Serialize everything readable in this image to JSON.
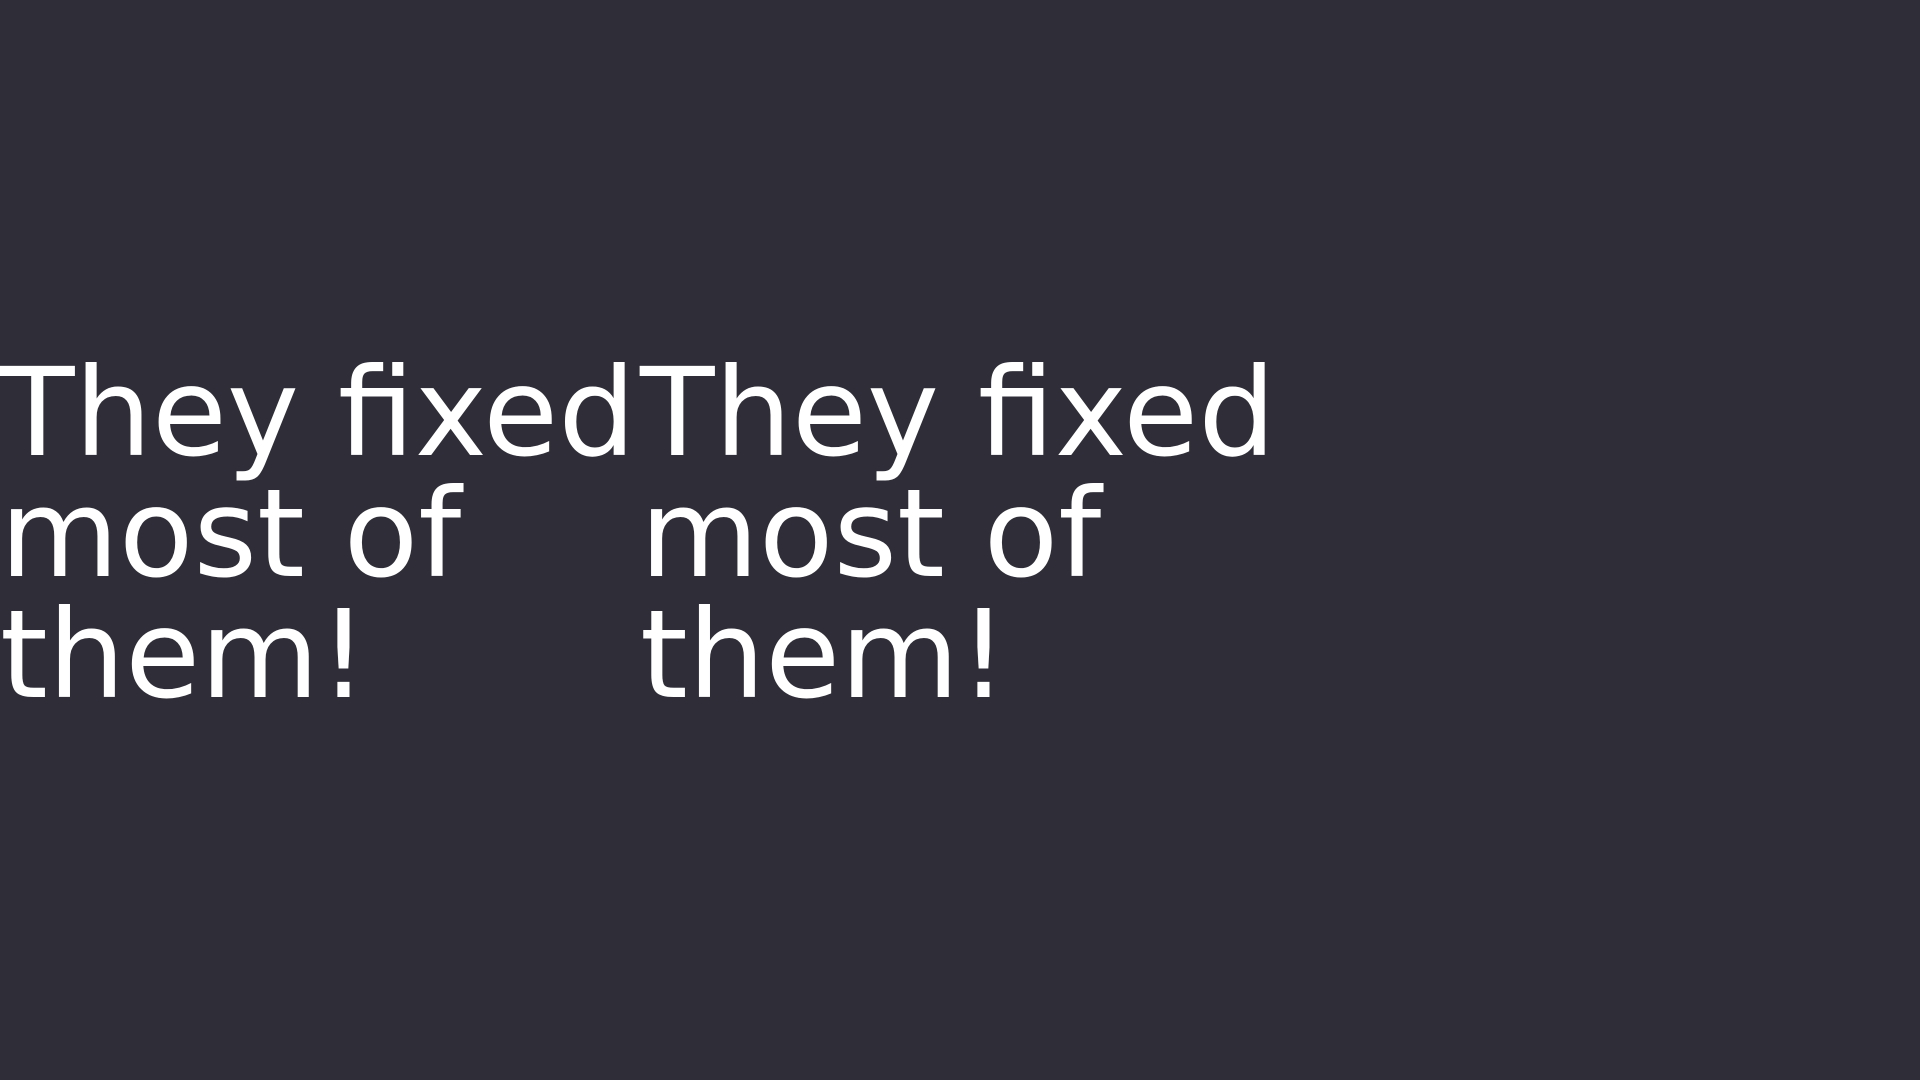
{
  "background_color": "#2f2e38",
  "text_color": "#ffffff",
  "captions": [
    {
      "text": "They fixed most of them!"
    },
    {
      "text": "They fixed most of them!"
    }
  ]
}
